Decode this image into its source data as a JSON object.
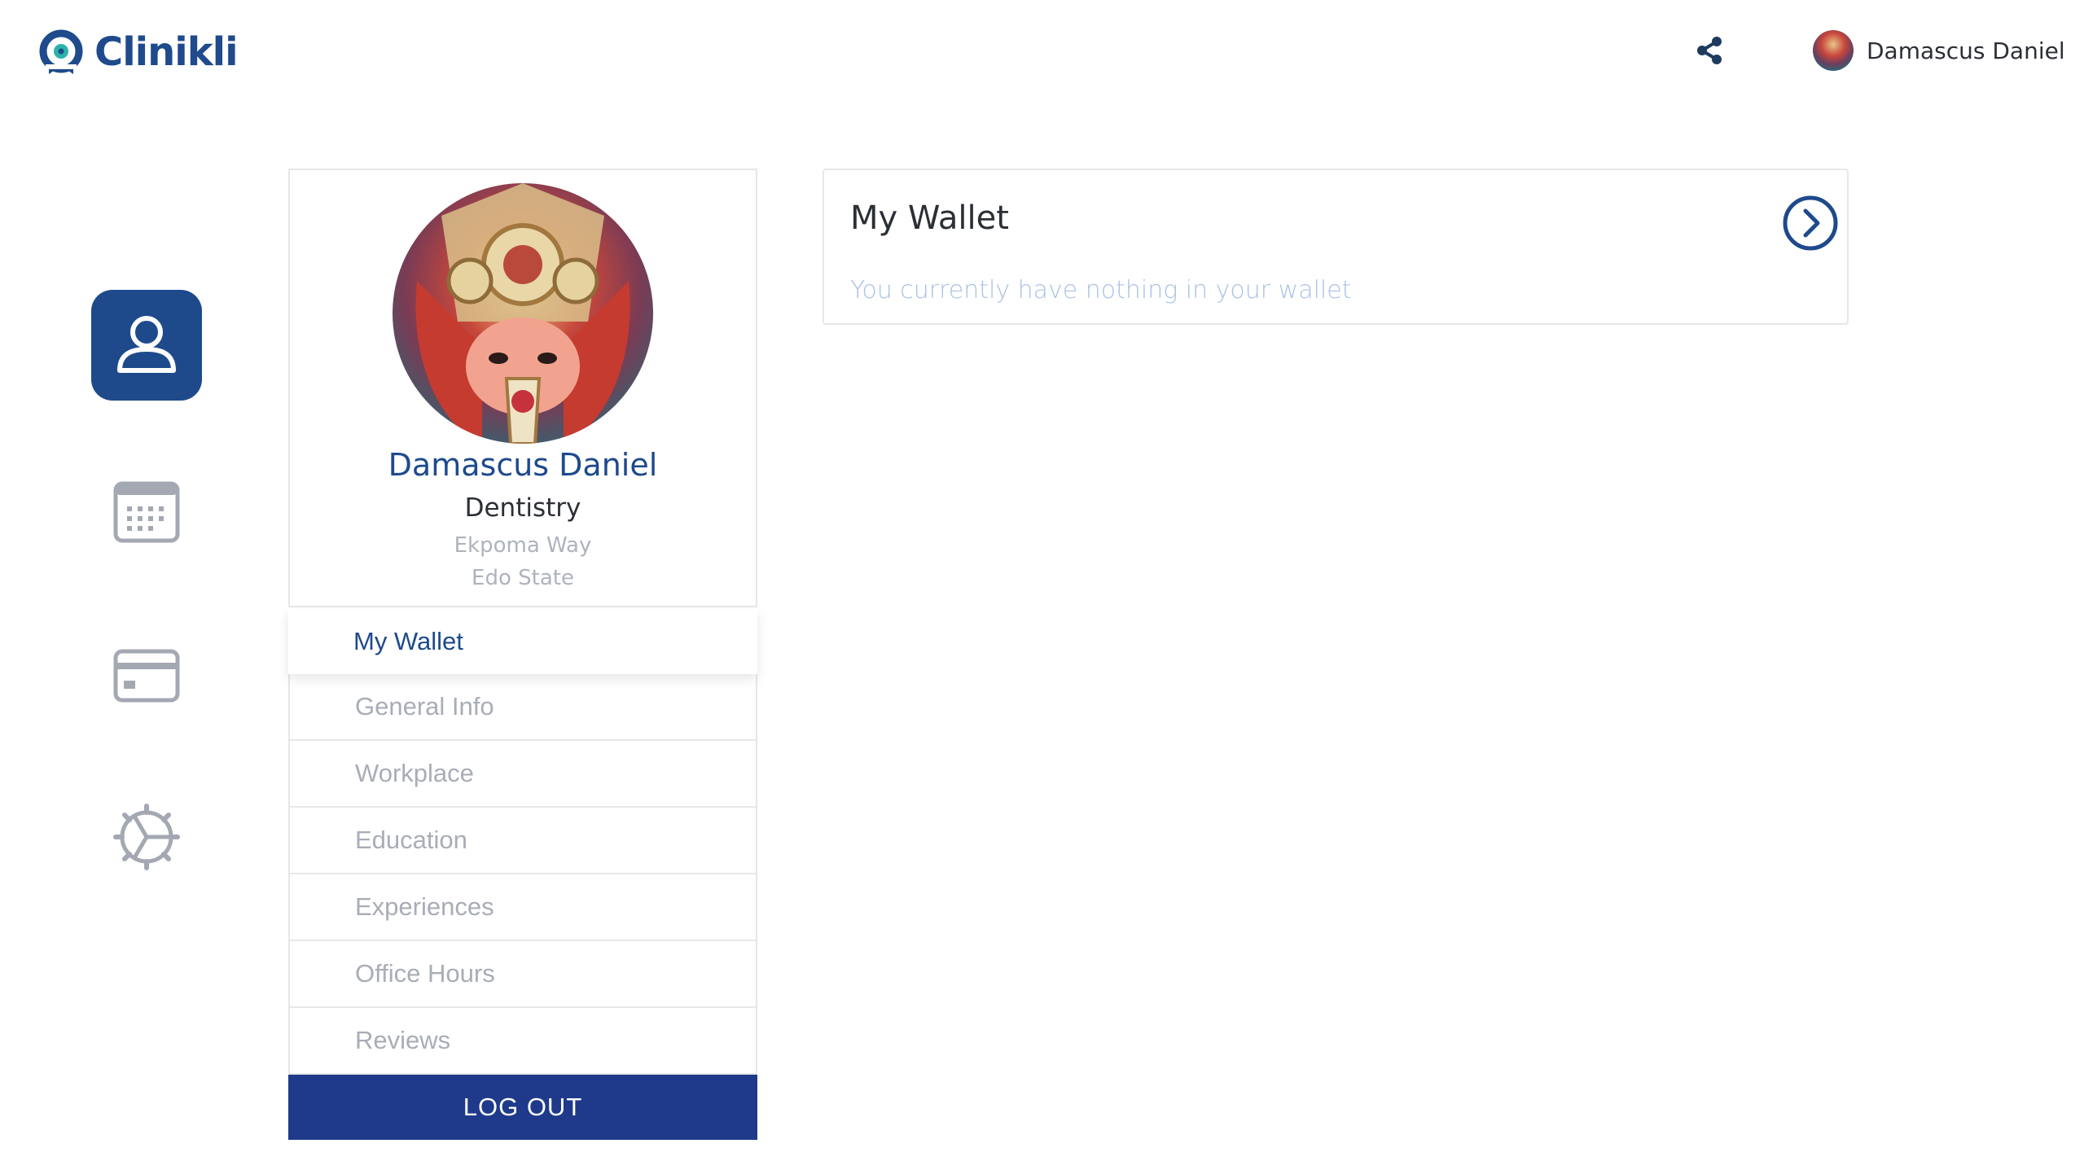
{
  "brand": {
    "name": "Clinikli",
    "color": "#1f4a8c",
    "accent": "#2bb3a8"
  },
  "header": {
    "share_icon": "share-icon",
    "user_name": "Damascus Daniel"
  },
  "rail": {
    "items": [
      {
        "name": "profile",
        "icon": "user-icon",
        "active": true
      },
      {
        "name": "calendar",
        "icon": "calendar-icon",
        "active": false
      },
      {
        "name": "payments",
        "icon": "card-icon",
        "active": false
      },
      {
        "name": "settings",
        "icon": "gear-icon",
        "active": false
      }
    ]
  },
  "profile": {
    "name": "Damascus Daniel",
    "specialty": "Dentistry",
    "address_line1": "Ekpoma Way",
    "address_line2": "Edo State"
  },
  "menu": {
    "items": [
      {
        "label": "My Wallet",
        "active": true
      },
      {
        "label": "General Info",
        "active": false
      },
      {
        "label": "Workplace",
        "active": false
      },
      {
        "label": "Education",
        "active": false
      },
      {
        "label": "Experiences",
        "active": false
      },
      {
        "label": "Office Hours",
        "active": false
      },
      {
        "label": "Reviews",
        "active": false
      }
    ],
    "logout_label": "LOG OUT"
  },
  "wallet": {
    "title": "My Wallet",
    "message": "You currently have nothing in your wallet",
    "go_icon": "chevron-right-circle-icon"
  },
  "colors": {
    "primary": "#1e4a8c",
    "logout_bg": "#1f3a8a",
    "muted_text": "#a8adb6",
    "hint_text": "#a9c2e4"
  }
}
